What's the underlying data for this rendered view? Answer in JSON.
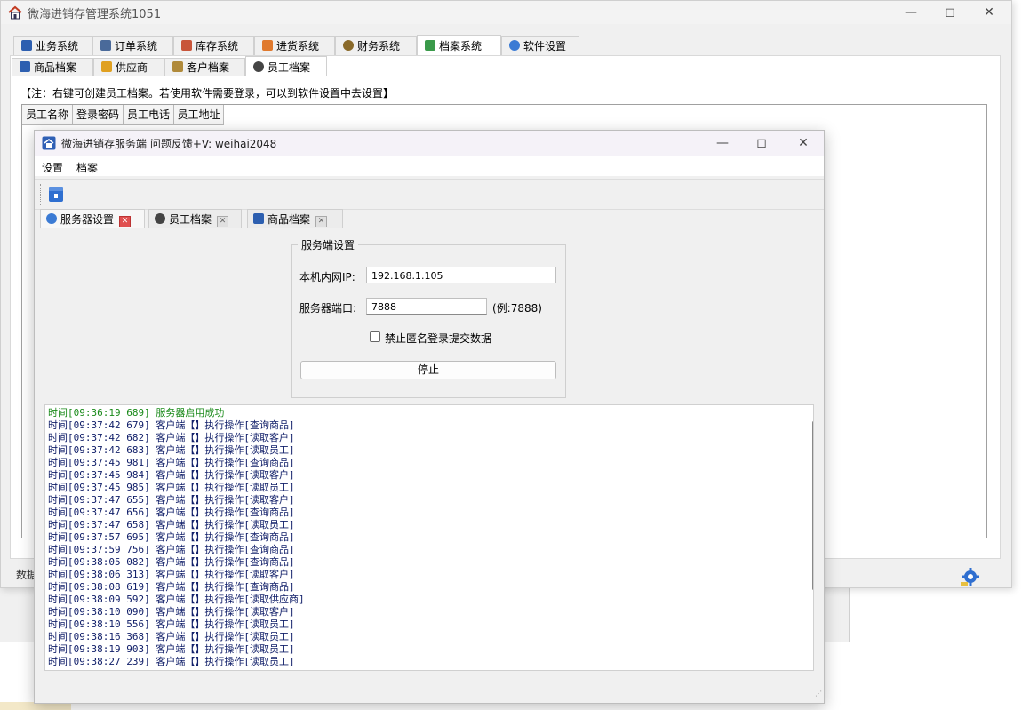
{
  "main": {
    "title": "微海进销存管理系统1051",
    "tabs": [
      {
        "label": "业务系统",
        "icon": "book-icon"
      },
      {
        "label": "订单系统",
        "icon": "order-icon"
      },
      {
        "label": "库存系统",
        "icon": "warehouse-icon"
      },
      {
        "label": "进货系统",
        "icon": "person-icon"
      },
      {
        "label": "财务系统",
        "icon": "magnifier-icon"
      },
      {
        "label": "档案系统",
        "icon": "archive-icon"
      },
      {
        "label": "软件设置",
        "icon": "gear-icon"
      }
    ],
    "subtabs": [
      {
        "label": "商品档案",
        "icon": "box-icon"
      },
      {
        "label": "供应商",
        "icon": "supplier-icon"
      },
      {
        "label": "客户档案",
        "icon": "customer-icon"
      },
      {
        "label": "员工档案",
        "icon": "employee-icon"
      }
    ],
    "note": "【注：右键可创建员工档案。若使用软件需要登录，可以到软件设置中去设置】",
    "grid_headers": [
      "员工名称",
      "登录密码",
      "员工电话",
      "员工地址"
    ],
    "status": "数据"
  },
  "server": {
    "title": "微海进销存服务端 问题反馈+V: weihai2048",
    "menu": [
      "设置",
      "档案"
    ],
    "tabs": [
      {
        "label": "服务器设置",
        "icon": "server-settings-icon"
      },
      {
        "label": "员工档案",
        "icon": "employee-icon"
      },
      {
        "label": "商品档案",
        "icon": "box-icon"
      }
    ],
    "group_title": "服务端设置",
    "ip_label": "本机内网IP:",
    "ip_value": "192.168.1.105",
    "port_label": "服务器端口:",
    "port_value": "7888",
    "port_hint": "(例:7888)",
    "anon_label": "禁止匿名登录提交数据",
    "anon_checked": false,
    "stop_label": "停止",
    "log": [
      "时间[09:36:19 689] 服务器启用成功",
      "时间[09:37:42 679] 客户端【】执行操作[查询商品]",
      "时间[09:37:42 682] 客户端【】执行操作[读取客户]",
      "时间[09:37:42 683] 客户端【】执行操作[读取员工]",
      "时间[09:37:45 981] 客户端【】执行操作[查询商品]",
      "时间[09:37:45 984] 客户端【】执行操作[读取客户]",
      "时间[09:37:45 985] 客户端【】执行操作[读取员工]",
      "时间[09:37:47 655] 客户端【】执行操作[读取客户]",
      "时间[09:37:47 656] 客户端【】执行操作[查询商品]",
      "时间[09:37:47 658] 客户端【】执行操作[读取员工]",
      "时间[09:37:57 695] 客户端【】执行操作[查询商品]",
      "时间[09:37:59 756] 客户端【】执行操作[查询商品]",
      "时间[09:38:05 082] 客户端【】执行操作[查询商品]",
      "时间[09:38:06 313] 客户端【】执行操作[读取客户]",
      "时间[09:38:08 619] 客户端【】执行操作[查询商品]",
      "时间[09:38:09 592] 客户端【】执行操作[读取供应商]",
      "时间[09:38:10 090] 客户端【】执行操作[读取客户]",
      "时间[09:38:10 556] 客户端【】执行操作[读取员工]",
      "时间[09:38:16 368] 客户端【】执行操作[读取员工]",
      "时间[09:38:19 903] 客户端【】执行操作[读取员工]",
      "时间[09:38:27 239] 客户端【】执行操作[读取员工]"
    ]
  }
}
